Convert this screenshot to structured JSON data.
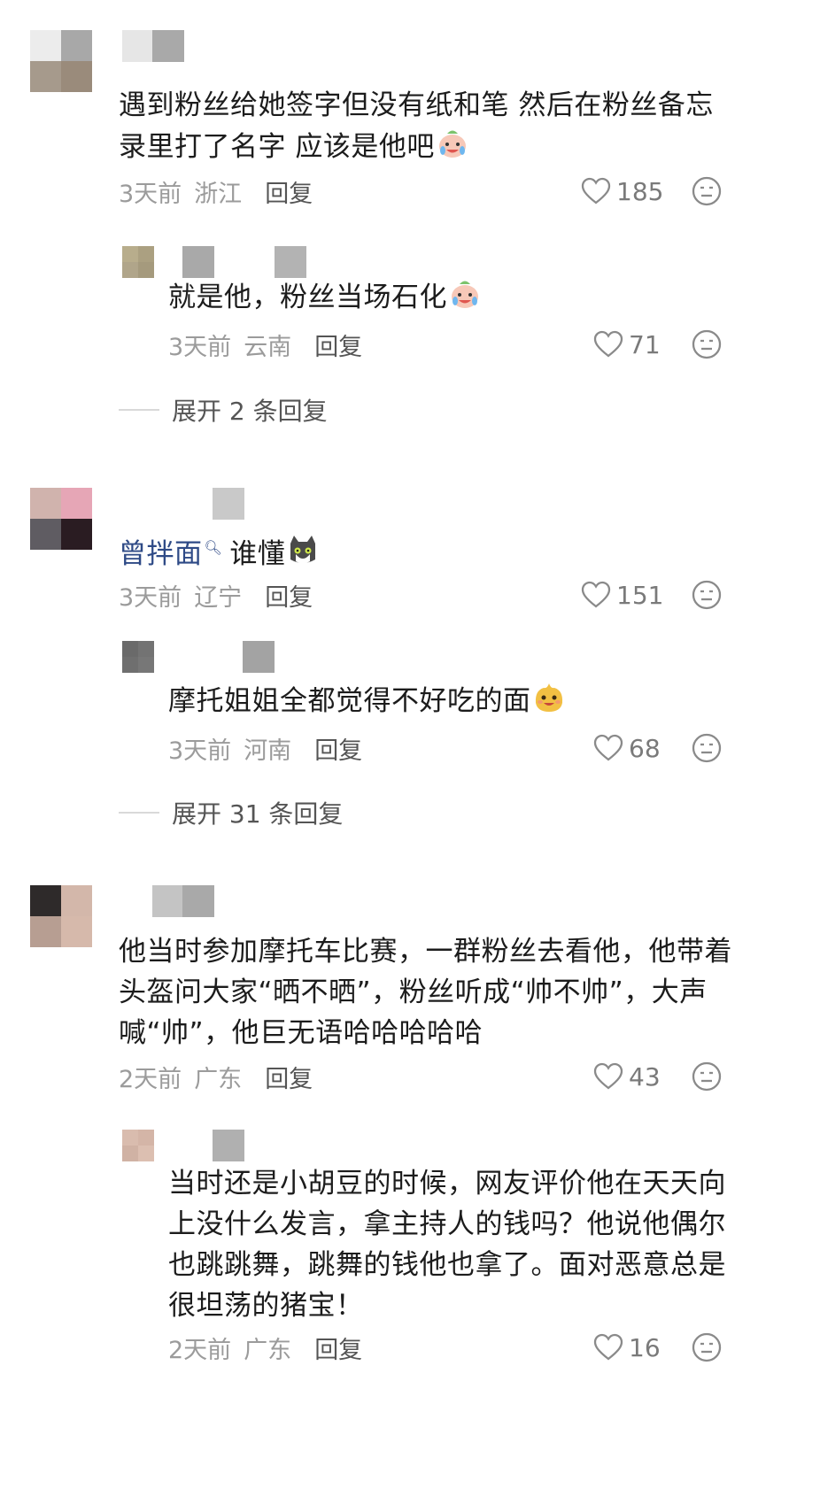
{
  "comments": [
    {
      "text": "遇到粉丝给她签字但没有纸和笔 然后在粉丝备忘录里打了名字 应该是他吧",
      "time": "3天前",
      "location": "浙江",
      "reply_label": "回复",
      "likes": "185",
      "replies": [
        {
          "text": "就是他，粉丝当场石化",
          "time": "3天前",
          "location": "云南",
          "reply_label": "回复",
          "likes": "71"
        }
      ],
      "expand_label": "展开 2 条回复"
    },
    {
      "link_text": "曾拌面",
      "text": "谁懂",
      "time": "3天前",
      "location": "辽宁",
      "reply_label": "回复",
      "likes": "151",
      "replies": [
        {
          "text": "摩托姐姐全都觉得不好吃的面",
          "time": "3天前",
          "location": "河南",
          "reply_label": "回复",
          "likes": "68"
        }
      ],
      "expand_label": "展开 31 条回复"
    },
    {
      "text": "他当时参加摩托车比赛，一群粉丝去看他，他带着头盔问大家“晒不晒”，粉丝听成“帅不帅”，大声喊“帅”，他巨无语哈哈哈哈哈",
      "time": "2天前",
      "location": "广东",
      "reply_label": "回复",
      "likes": "43",
      "replies": [
        {
          "text": "当时还是小胡豆的时候，网友评价他在天天向上没什么发言，拿主持人的钱吗？他说他偶尔也跳跳舞，跳舞的钱他也拿了。面对恶意总是很坦荡的猪宝！",
          "time": "2天前",
          "location": "广东",
          "reply_label": "回复",
          "likes": "16"
        }
      ]
    }
  ],
  "icons": {
    "like": "heart-outline-icon",
    "emoji_react": "neutral-face-icon",
    "search": "search-icon"
  },
  "colors": {
    "text": "#1c1c1c",
    "meta": "#9b9b9b",
    "link": "#2e4a86"
  }
}
